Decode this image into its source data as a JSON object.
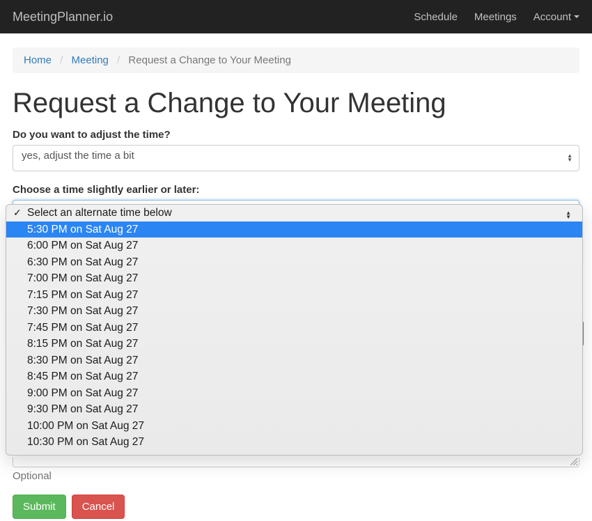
{
  "navbar": {
    "brand": "MeetingPlanner.io",
    "links": [
      "Schedule",
      "Meetings"
    ],
    "account_label": "Account"
  },
  "breadcrumb": {
    "items": [
      "Home",
      "Meeting"
    ],
    "current": "Request a Change to Your Meeting"
  },
  "page_title": "Request a Change to Your Meeting",
  "form": {
    "adjust_label": "Do you want to adjust the time?",
    "adjust_value": "yes, adjust the time a bit",
    "alt_label": "Choose a time slightly earlier or later:",
    "alt_selected": "Select an alternate time below",
    "alt_highlight": "5:30 PM on Sat Aug 27",
    "alt_options": [
      "Select an alternate time below",
      "5:30 PM on Sat Aug 27",
      "6:00 PM on Sat Aug 27",
      "6:30 PM on Sat Aug 27",
      "7:00 PM on Sat Aug 27",
      "7:15 PM on Sat Aug 27",
      "7:30 PM on Sat Aug 27",
      "7:45 PM on Sat Aug 27",
      "8:15 PM on Sat Aug 27",
      "8:30 PM on Sat Aug 27",
      "8:45 PM on Sat Aug 27",
      "9:00 PM on Sat Aug 27",
      "9:30 PM on Sat Aug 27",
      "10:00 PM on Sat Aug 27",
      "10:30 PM on Sat Aug 27"
    ],
    "optional_help": "Optional",
    "submit_label": "Submit",
    "cancel_label": "Cancel"
  }
}
